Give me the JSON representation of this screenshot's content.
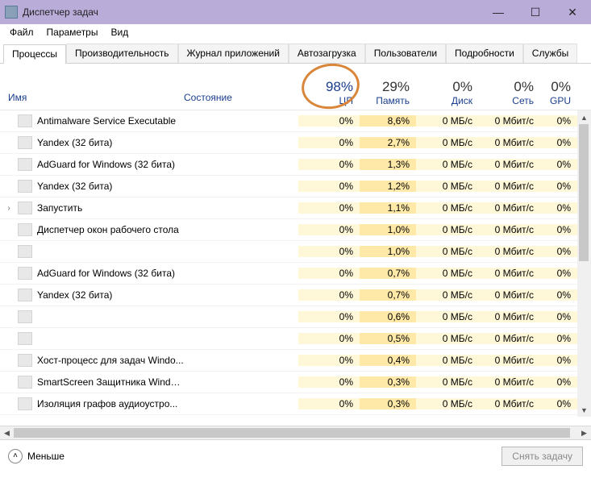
{
  "window": {
    "title": "Диспетчер задач"
  },
  "menu": {
    "file": "Файл",
    "options": "Параметры",
    "view": "Вид"
  },
  "tabs": {
    "processes": "Процессы",
    "performance": "Производительность",
    "apphistory": "Журнал приложений",
    "startup": "Автозагрузка",
    "users": "Пользователи",
    "details": "Подробности",
    "services": "Службы"
  },
  "columns": {
    "name": "Имя",
    "status": "Состояние",
    "cpu": {
      "pct": "98%",
      "label": "ЦП"
    },
    "mem": {
      "pct": "29%",
      "label": "Память"
    },
    "disk": {
      "pct": "0%",
      "label": "Диск"
    },
    "net": {
      "pct": "0%",
      "label": "Сеть"
    },
    "gpu": {
      "pct": "0%",
      "label": "GPU"
    }
  },
  "rows": [
    {
      "exp": "",
      "name": "Antimalware Service Executable",
      "cpu": "0%",
      "mem": "8,6%",
      "disk": "0 МБ/с",
      "net": "0 Мбит/с",
      "gpu": "0%"
    },
    {
      "exp": "",
      "name": "Yandex (32 бита)",
      "cpu": "0%",
      "mem": "2,7%",
      "disk": "0 МБ/с",
      "net": "0 Мбит/с",
      "gpu": "0%"
    },
    {
      "exp": "",
      "name": "AdGuard for Windows (32 бита)",
      "cpu": "0%",
      "mem": "1,3%",
      "disk": "0 МБ/с",
      "net": "0 Мбит/с",
      "gpu": "0%"
    },
    {
      "exp": "",
      "name": "Yandex (32 бита)",
      "cpu": "0%",
      "mem": "1,2%",
      "disk": "0 МБ/с",
      "net": "0 Мбит/с",
      "gpu": "0%"
    },
    {
      "exp": "›",
      "name": "Запустить",
      "cpu": "0%",
      "mem": "1,1%",
      "disk": "0 МБ/с",
      "net": "0 Мбит/с",
      "gpu": "0%"
    },
    {
      "exp": "",
      "name": "Диспетчер окон рабочего стола",
      "cpu": "0%",
      "mem": "1,0%",
      "disk": "0 МБ/с",
      "net": "0 Мбит/с",
      "gpu": "0%"
    },
    {
      "exp": "",
      "name": "",
      "cpu": "0%",
      "mem": "1,0%",
      "disk": "0 МБ/с",
      "net": "0 Мбит/с",
      "gpu": "0%"
    },
    {
      "exp": "",
      "name": "AdGuard for Windows (32 бита)",
      "cpu": "0%",
      "mem": "0,7%",
      "disk": "0 МБ/с",
      "net": "0 Мбит/с",
      "gpu": "0%"
    },
    {
      "exp": "",
      "name": "Yandex (32 бита)",
      "cpu": "0%",
      "mem": "0,7%",
      "disk": "0 МБ/с",
      "net": "0 Мбит/с",
      "gpu": "0%"
    },
    {
      "exp": "",
      "name": "",
      "cpu": "0%",
      "mem": "0,6%",
      "disk": "0 МБ/с",
      "net": "0 Мбит/с",
      "gpu": "0%"
    },
    {
      "exp": "",
      "name": "",
      "cpu": "0%",
      "mem": "0,5%",
      "disk": "0 МБ/с",
      "net": "0 Мбит/с",
      "gpu": "0%"
    },
    {
      "exp": "",
      "name": "Хост-процесс для задач Windo...",
      "cpu": "0%",
      "mem": "0,4%",
      "disk": "0 МБ/с",
      "net": "0 Мбит/с",
      "gpu": "0%"
    },
    {
      "exp": "",
      "name": "SmartScreen Защитника Windo...",
      "cpu": "0%",
      "mem": "0,3%",
      "disk": "0 МБ/с",
      "net": "0 Мбит/с",
      "gpu": "0%"
    },
    {
      "exp": "",
      "name": "Изоляция графов аудиоустро...",
      "cpu": "0%",
      "mem": "0,3%",
      "disk": "0 МБ/с",
      "net": "0 Мбит/с",
      "gpu": "0%"
    }
  ],
  "footer": {
    "fewer": "Меньше",
    "end_task": "Снять задачу"
  }
}
